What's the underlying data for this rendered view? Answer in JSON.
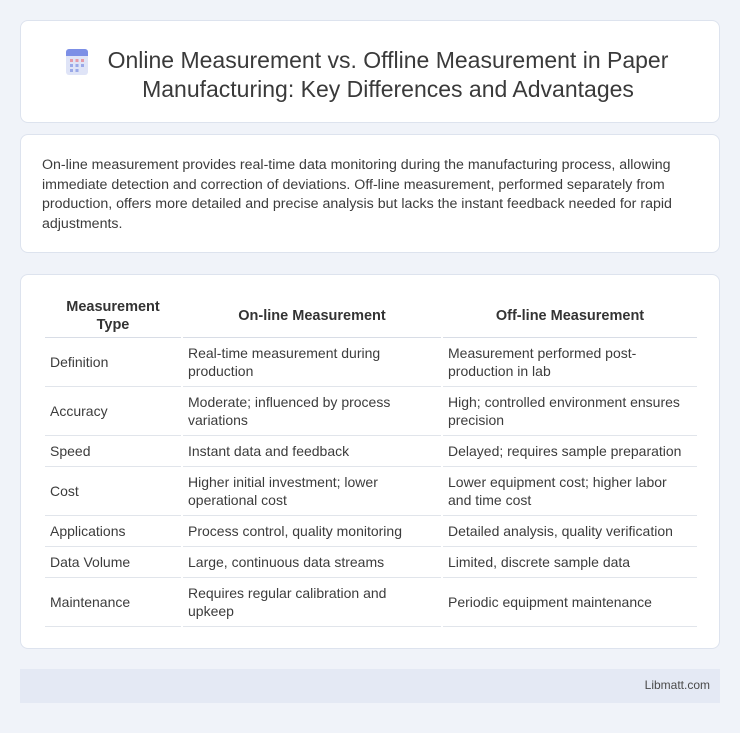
{
  "header": {
    "icon": "document-icon",
    "title": "Online Measurement vs. Offline Measurement in Paper Manufacturing: Key Differences and Advantages"
  },
  "summary": {
    "text": "On-line measurement provides real-time data monitoring during the manufacturing process, allowing immediate detection and correction of deviations. Off-line measurement, performed separately from production, offers more detailed and precise analysis but lacks the instant feedback needed for rapid adjustments."
  },
  "table": {
    "headers": [
      "Measurement Type",
      "On-line Measurement",
      "Off-line Measurement"
    ],
    "rows": [
      [
        "Definition",
        "Real-time measurement during production",
        "Measurement performed post-production in lab"
      ],
      [
        "Accuracy",
        "Moderate; influenced by process variations",
        "High; controlled environment ensures precision"
      ],
      [
        "Speed",
        "Instant data and feedback",
        "Delayed; requires sample preparation"
      ],
      [
        "Cost",
        "Higher initial investment; lower operational cost",
        "Lower equipment cost; higher labor and time cost"
      ],
      [
        "Applications",
        "Process control, quality monitoring",
        "Detailed analysis, quality verification"
      ],
      [
        "Data Volume",
        "Large, continuous data streams",
        "Limited, discrete sample data"
      ],
      [
        "Maintenance",
        "Requires regular calibration and upkeep",
        "Periodic equipment maintenance"
      ]
    ]
  },
  "footer": {
    "site": "Libmatt.com"
  },
  "colors": {
    "background": "#f0f3f9",
    "card": "#ffffff",
    "footer": "#e4e9f4"
  }
}
